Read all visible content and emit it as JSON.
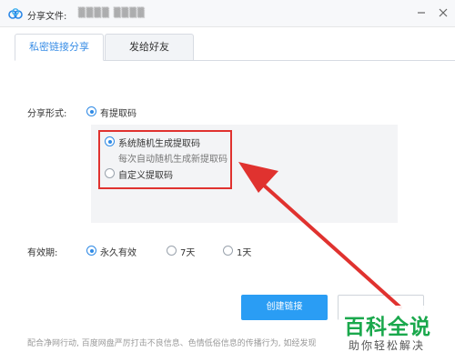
{
  "window": {
    "title_label": "分享文件:",
    "file_name": "▒▒▒▒ ▒▒▒▒"
  },
  "tabs": [
    {
      "label": "私密链接分享",
      "active": true
    },
    {
      "label": "发给好友",
      "active": false
    }
  ],
  "share_form": {
    "label": "分享形式:",
    "option": "有提取码",
    "sub_options": [
      {
        "label": "系统随机生成提取码",
        "desc": "每次自动随机生成新提取码",
        "selected": true
      },
      {
        "label": "自定义提取码",
        "selected": false
      }
    ]
  },
  "validity": {
    "label": "有效期:",
    "options": [
      {
        "label": "永久有效",
        "selected": true
      },
      {
        "label": "7天",
        "selected": false
      },
      {
        "label": "1天",
        "selected": false
      }
    ]
  },
  "buttons": {
    "create": "创建链接"
  },
  "notice": "配合净网行动, 百度网盘严厉打击不良信息、色情低俗信息的传播行为, 如经发现",
  "watermark": {
    "title": "百科全说",
    "subtitle": "助你轻松解决"
  },
  "colors": {
    "accent": "#2a9df4",
    "annotation": "#e0322f",
    "watermark": "#1aa84c"
  }
}
